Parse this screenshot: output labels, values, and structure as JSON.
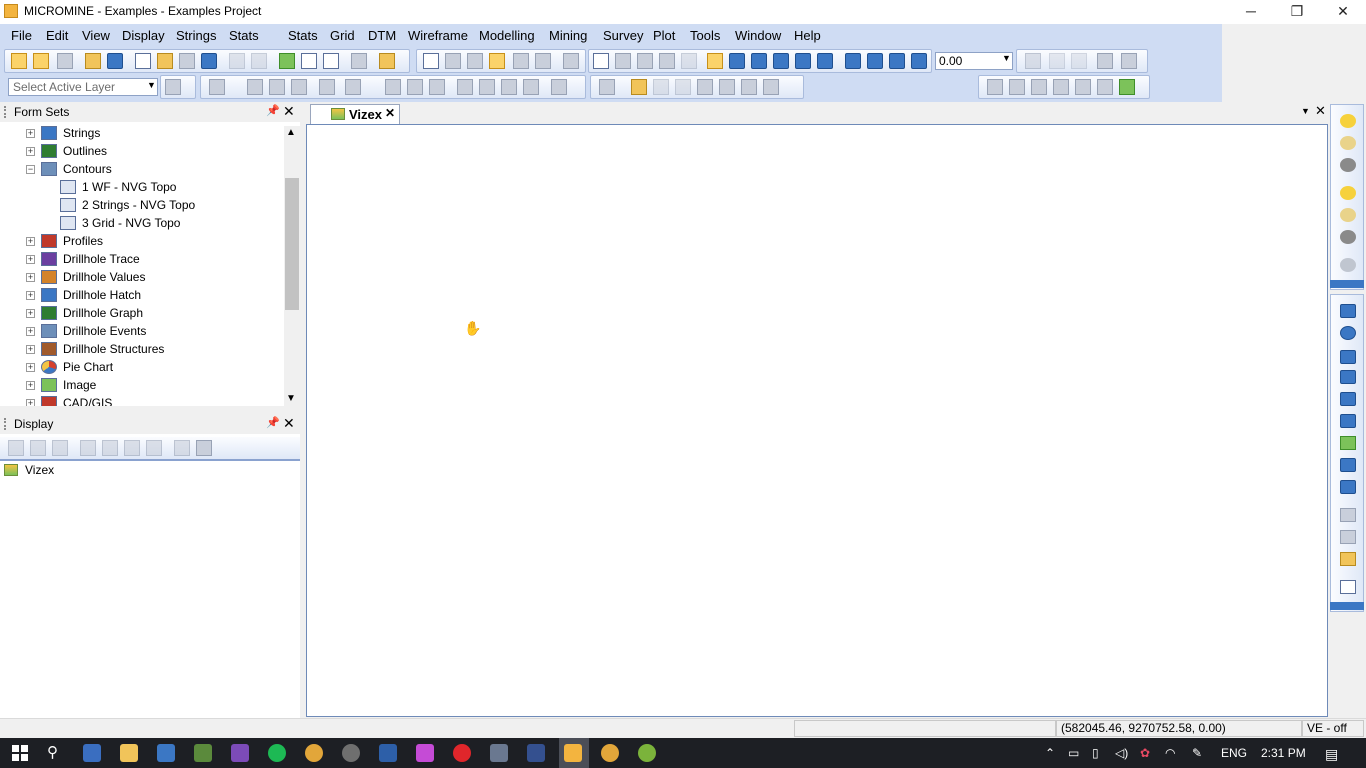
{
  "window": {
    "title": "MICROMINE - Examples - Examples Project",
    "controls": [
      "─",
      "❐",
      "✕"
    ]
  },
  "menu": [
    "File",
    "Edit",
    "View",
    "Display",
    "Strings",
    "Stats",
    "Grid",
    "DTM",
    "Wireframe",
    "Modelling",
    "Mining",
    "Survey",
    "Plot",
    "Tools",
    "Window",
    "Help"
  ],
  "toolbar": {
    "numeric_value": "0.00",
    "layer_placeholder": "Select Active Layer"
  },
  "form_sets": {
    "header": "Form Sets",
    "items": [
      {
        "label": "Strings",
        "icon": "strings-icon",
        "level": 0,
        "expander": "+"
      },
      {
        "label": "Outlines",
        "icon": "outlines-icon",
        "level": 0,
        "expander": "+"
      },
      {
        "label": "Contours",
        "icon": "contours-icon",
        "level": 0,
        "expander": "−"
      },
      {
        "label": "1 WF - NVG Topo",
        "icon": "form-icon",
        "level": 1
      },
      {
        "label": "2 Strings - NVG Topo",
        "icon": "form-icon",
        "level": 1
      },
      {
        "label": "3 Grid - NVG Topo",
        "icon": "form-icon",
        "level": 1
      },
      {
        "label": "Profiles",
        "icon": "profiles-icon",
        "level": 0,
        "expander": "+"
      },
      {
        "label": "Drillhole Trace",
        "icon": "drillhole-trace-icon",
        "level": 0,
        "expander": "+"
      },
      {
        "label": "Drillhole Values",
        "icon": "drillhole-values-icon",
        "level": 0,
        "expander": "+"
      },
      {
        "label": "Drillhole Hatch",
        "icon": "drillhole-hatch-icon",
        "level": 0,
        "expander": "+"
      },
      {
        "label": "Drillhole Graph",
        "icon": "drillhole-graph-icon",
        "level": 0,
        "expander": "+"
      },
      {
        "label": "Drillhole Events",
        "icon": "drillhole-events-icon",
        "level": 0,
        "expander": "+"
      },
      {
        "label": "Drillhole Structures",
        "icon": "drillhole-structures-icon",
        "level": 0,
        "expander": "+"
      },
      {
        "label": "Pie Chart",
        "icon": "pie-chart-icon",
        "level": 0,
        "expander": "+"
      },
      {
        "label": "Image",
        "icon": "image-icon",
        "level": 0,
        "expander": "+"
      },
      {
        "label": "CAD/GIS",
        "icon": "cad-gis-icon",
        "level": 0,
        "expander": "+"
      }
    ]
  },
  "display_panel": {
    "header": "Display",
    "items": [
      {
        "label": "Vizex",
        "icon": "vizex-icon"
      }
    ]
  },
  "document": {
    "tab_label": "Vizex"
  },
  "status": {
    "coordinates": "(582045.46, 9270752.58, 0.00)",
    "ve": "VE - off"
  },
  "taskbar": {
    "language": "ENG",
    "time": "2:31 PM"
  },
  "colors": {
    "menu_bg": "#cfdcf3",
    "accent_blue": "#3b77c4",
    "taskbar_bg": "#1d1f24"
  }
}
